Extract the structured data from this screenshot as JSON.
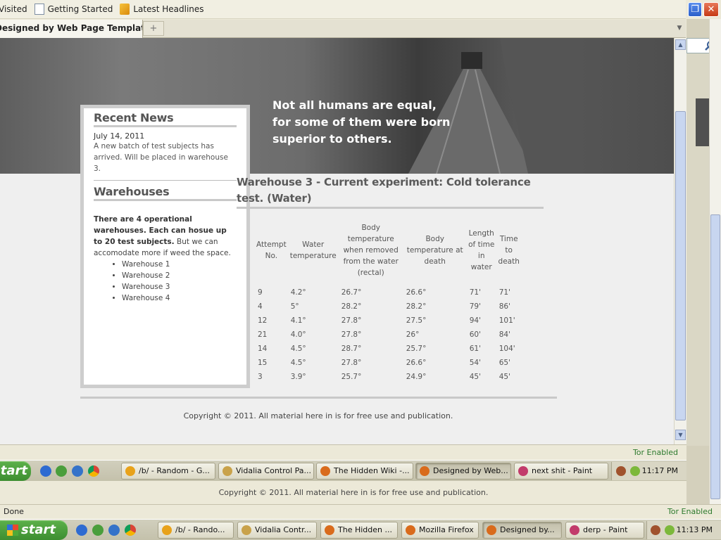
{
  "bookmarks": {
    "items": [
      {
        "label": "Visited",
        "icon": "none"
      },
      {
        "label": "Getting Started",
        "icon": "page-icon"
      },
      {
        "label": "Latest Headlines",
        "icon": "rss-icon"
      }
    ]
  },
  "tab": {
    "title": "Designed by Web Page Templates",
    "new_tab_glyph": "+"
  },
  "banner": {
    "tagline_lines": [
      "Not all humans are equal,",
      "for some of them were born",
      "superior to others."
    ]
  },
  "sidebar": {
    "news_heading": "Recent News",
    "news_date": "July 14, 2011",
    "news_text": "A new batch of test subjects has arrived. Will be placed in warehouse 3.",
    "warehouses_heading": "Warehouses",
    "intro_bold": "There are 4 operational warehouses. Each can hosue up to 20 test subjects.",
    "intro_rest": " But we can accomodate more if weed the space.",
    "warehouses": [
      "Warehouse 1",
      "Warehouse 2",
      "Warehouse 3",
      "Warehouse 4"
    ]
  },
  "main": {
    "title": "Warehouse 3 - Current experiment: Cold tolerance test. (Water)",
    "table": {
      "headers": [
        "Attempt No.",
        "Water temperature",
        "Body temperature when removed from the water (rectal)",
        "Body temperature at death",
        "Length of time in water",
        "Time to death"
      ],
      "rows": [
        [
          "9",
          "4.2°",
          "26.7°",
          "26.6°",
          "71'",
          "71'"
        ],
        [
          "4",
          "5°",
          "28.2°",
          "28.2°",
          "79'",
          "86'"
        ],
        [
          "12",
          "4.1°",
          "27.8°",
          "27.5°",
          "94'",
          "101'"
        ],
        [
          "21",
          "4.0°",
          "27.8°",
          "26°",
          "60'",
          "84'"
        ],
        [
          "14",
          "4.5°",
          "28.7°",
          "25.7°",
          "61'",
          "104'"
        ],
        [
          "15",
          "4.5°",
          "27.8°",
          "26.6°",
          "54'",
          "65'"
        ],
        [
          "3",
          "3.9°",
          "25.7°",
          "24.9°",
          "45'",
          "45'"
        ]
      ]
    }
  },
  "footer": {
    "copyright": "Copyright © 2011. All material here in is for free use and publication."
  },
  "inner_status": {
    "tor": "Tor Enabled"
  },
  "inner_taskbar": {
    "start": "start",
    "buttons": [
      {
        "label": "/b/ - Random - G...",
        "icon_color": "#e8a21a",
        "active": false
      },
      {
        "label": "Vidalia Control Pa...",
        "icon_color": "#c9a24a",
        "active": false
      },
      {
        "label": "The Hidden Wiki -...",
        "icon_color": "#d96b1c",
        "active": false
      },
      {
        "label": "Designed by Web...",
        "icon_color": "#d96b1c",
        "active": true
      },
      {
        "label": "next shit - Paint",
        "icon_color": "#c23b6b",
        "active": false
      }
    ],
    "clock": "11:17 PM"
  },
  "outer_footer": {
    "copyright": "Copyright © 2011. All material here in is for free use and publication."
  },
  "outer_status": {
    "done": "Done",
    "tor": "Tor Enabled"
  },
  "outer_taskbar": {
    "start": "start",
    "buttons": [
      {
        "label": "/b/ - Rando...",
        "icon_color": "#e8a21a",
        "active": false
      },
      {
        "label": "Vidalia Contr...",
        "icon_color": "#c9a24a",
        "active": false
      },
      {
        "label": "The Hidden ...",
        "icon_color": "#d96b1c",
        "active": false
      },
      {
        "label": "Mozilla Firefox",
        "icon_color": "#d96b1c",
        "active": false
      },
      {
        "label": "Designed by...",
        "icon_color": "#d96b1c",
        "active": true
      },
      {
        "label": "derp - Paint",
        "icon_color": "#c23b6b",
        "active": false
      }
    ],
    "clock": "11:13 PM"
  },
  "colors": {
    "xp_green": "#3d8e31",
    "tor_green": "#2d7a2d",
    "page_bg": "#efefef",
    "border_gray": "#c9c9c9"
  }
}
